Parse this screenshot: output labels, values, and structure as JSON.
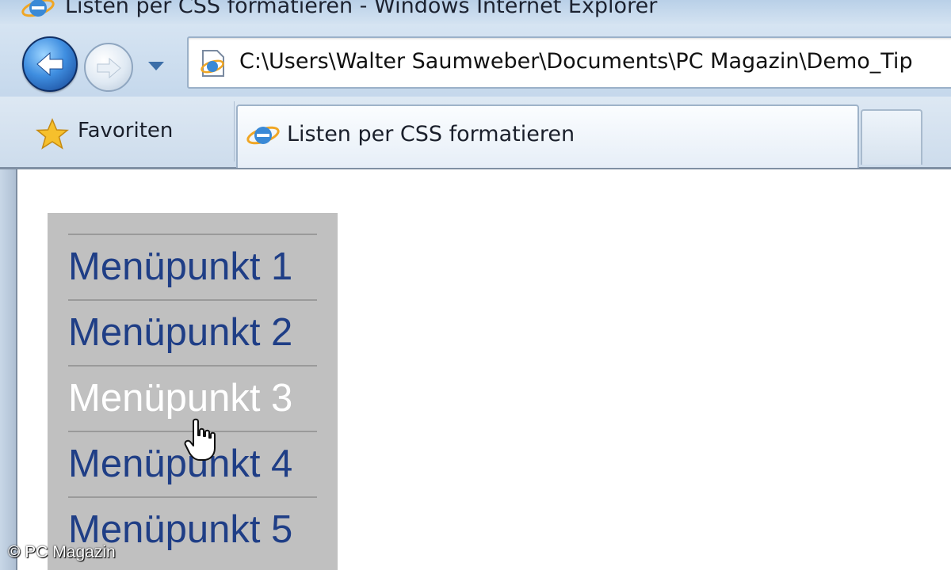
{
  "window": {
    "title": "Listen per CSS formatieren - Windows Internet Explorer"
  },
  "navigation": {
    "back_icon": "back-arrow-icon",
    "forward_icon": "forward-arrow-icon",
    "history_icon": "chevron-down-icon",
    "address_url": "C:\\Users\\Walter Saumweber\\Documents\\PC Magazin\\Demo_Tip"
  },
  "tabs": {
    "favorites_label": "Favoriten",
    "active_tab_label": "Listen per CSS formatieren"
  },
  "menu": {
    "items": [
      {
        "label": "Menüpunkt 1"
      },
      {
        "label": "Menüpunkt 2"
      },
      {
        "label": "Menüpunkt 3",
        "state": "hover"
      },
      {
        "label": "Menüpunkt 4"
      },
      {
        "label": "Menüpunkt 5"
      }
    ],
    "background_color": "#c0c0c0",
    "link_color": "#1f3e86",
    "hover_color": "#ffffff"
  },
  "watermark": "© PC Magazin"
}
